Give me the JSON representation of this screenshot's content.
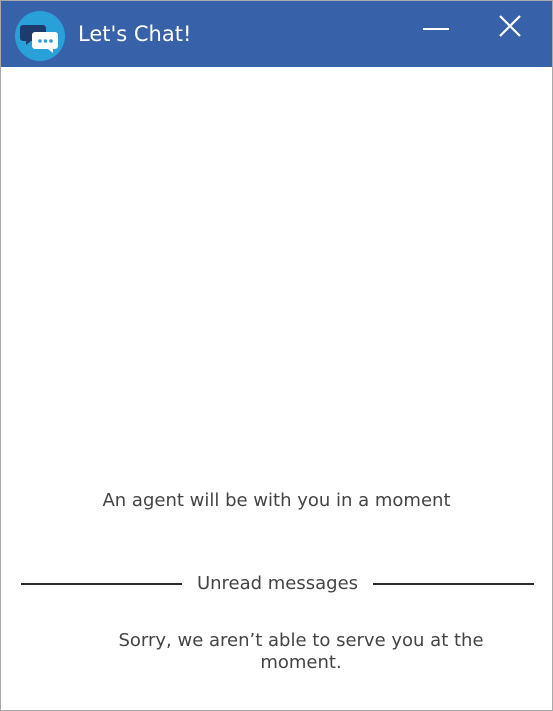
{
  "window": {
    "title": "Let's Chat!",
    "app_icon": "chat-bubbles-icon",
    "minimize_icon": "minimize-icon",
    "close_icon": "close-icon",
    "titlebar_color": "#3762aa",
    "icon_color": "#2aa0d8"
  },
  "chat": {
    "agent_notice": "An agent will be with you in a moment",
    "divider_label": "Unread messages",
    "system_message": "Sorry, we aren’t able to serve you at the moment."
  }
}
